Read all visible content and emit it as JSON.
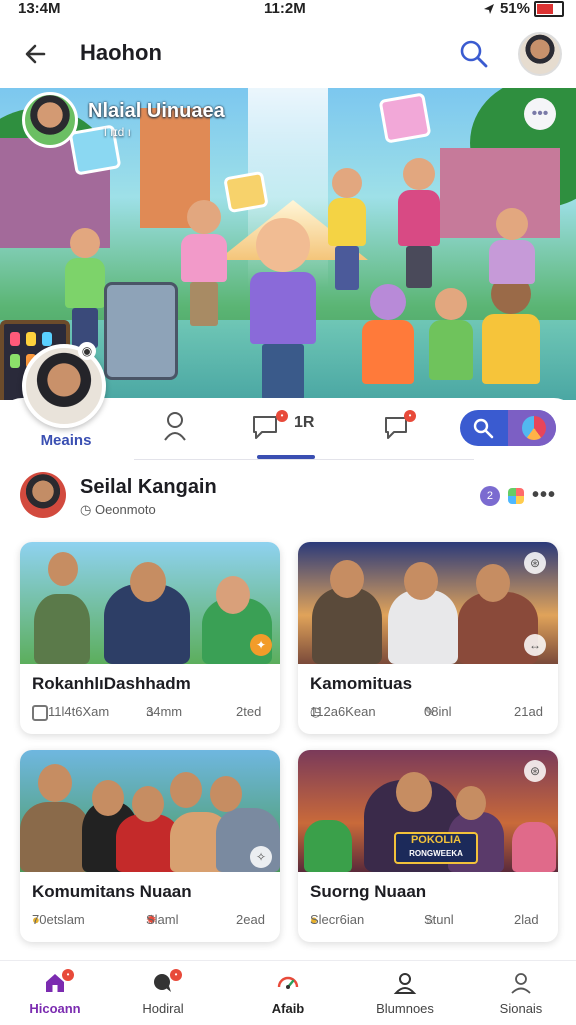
{
  "status_bar": {
    "time_left": "13:4M",
    "time_center": "11:2M",
    "battery_text": "51%"
  },
  "app_bar": {
    "title": "Haohon"
  },
  "group": {
    "name": "Nlaial Uinuaea",
    "subtitle": "l ıɪd ı"
  },
  "profile": {
    "label": "Meains"
  },
  "tabs": {
    "count_text": "1R"
  },
  "community": {
    "name": "Seilal Kangain",
    "meta": "Oeonmoto"
  },
  "cards": [
    {
      "title": "RokanhlıDashhadm",
      "stat1": "11l4t6Xam",
      "stat2": "34mm",
      "stat3": "2ted"
    },
    {
      "title": "Kamomituas",
      "stat1": "112a6Kean",
      "stat2": "08inl",
      "stat3": "21ad"
    },
    {
      "title": "Komumitans Nuaan",
      "stat1": "70etslam",
      "stat2": "Slaml",
      "stat3": "2ead"
    },
    {
      "title": "Suorng Nuaan",
      "stat1": "Slecr6ian",
      "stat2": "Stunl",
      "stat3": "2lad"
    }
  ],
  "poster_text": {
    "line1": "POKOLIA",
    "line2": "RONGWEEKA"
  },
  "bottom_nav": [
    {
      "label": "Hicoann",
      "icon": "home-icon"
    },
    {
      "label": "Hodiral",
      "icon": "chat-icon"
    },
    {
      "label": "Afaib",
      "icon": "gauge-icon"
    },
    {
      "label": "Blumnoes",
      "icon": "profile-icon"
    },
    {
      "label": "Sionais",
      "icon": "user-icon"
    }
  ],
  "colors": {
    "accent": "#3a4fb2",
    "home_active": "#7b2bb0",
    "badge": "#e84a3a"
  }
}
